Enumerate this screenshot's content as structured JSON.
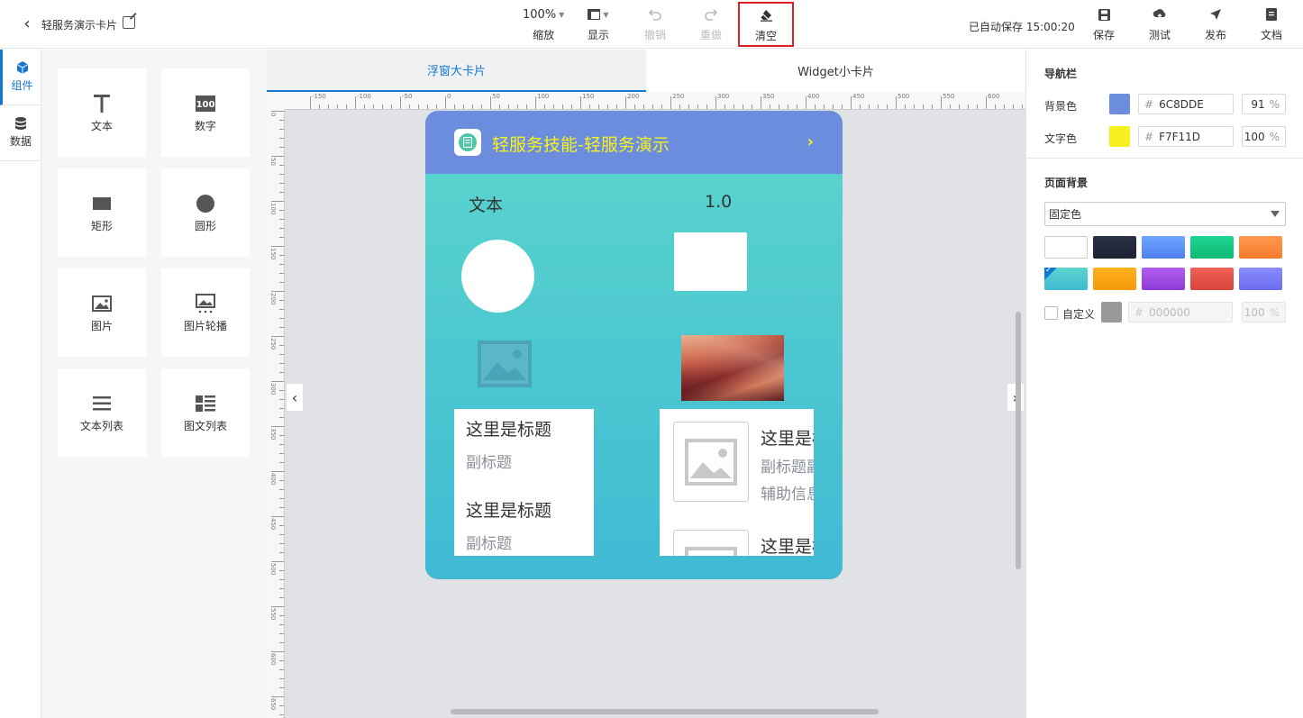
{
  "header": {
    "title": "轻服务演示卡片",
    "zoom": {
      "value": "100%",
      "label": "缩放"
    },
    "display": {
      "label": "显示"
    },
    "undo": {
      "label": "撤销"
    },
    "redo": {
      "label": "重做"
    },
    "clear": {
      "label": "清空"
    },
    "autosave": "已自动保存 15:00:20",
    "save": {
      "label": "保存"
    },
    "test": {
      "label": "测试"
    },
    "publish": {
      "label": "发布"
    },
    "docs": {
      "label": "文档"
    }
  },
  "sidebar_tabs": [
    {
      "label": "组件",
      "icon": "cube-icon",
      "active": true
    },
    {
      "label": "数据",
      "icon": "database-icon",
      "active": false
    }
  ],
  "components": [
    {
      "label": "文本",
      "icon": "text-icon"
    },
    {
      "label": "数字",
      "icon": "number-icon"
    },
    {
      "label": "矩形",
      "icon": "rectangle-icon"
    },
    {
      "label": "圆形",
      "icon": "circle-icon"
    },
    {
      "label": "图片",
      "icon": "image-icon"
    },
    {
      "label": "图片轮播",
      "icon": "carousel-icon"
    },
    {
      "label": "文本列表",
      "icon": "text-list-icon"
    },
    {
      "label": "图文列表",
      "icon": "image-text-list-icon"
    }
  ],
  "canvas_tabs": [
    {
      "label": "浮窗大卡片",
      "active": true
    },
    {
      "label": "Widget小卡片",
      "active": false
    }
  ],
  "ruler": {
    "h_labels": [
      "-150",
      "-100",
      "-50",
      "0",
      "50",
      "100",
      "150",
      "200",
      "250",
      "300",
      "350",
      "400",
      "450",
      "500",
      "550",
      "600",
      "650"
    ],
    "v_labels": [
      "0",
      "50",
      "100",
      "150",
      "200",
      "250",
      "300",
      "350",
      "400",
      "450",
      "500",
      "550",
      "600",
      "650"
    ]
  },
  "card": {
    "title": "轻服务技能-轻服务演示",
    "nav_bg": "#6c8dde",
    "title_color": "#f7f11d",
    "text_el": "文本",
    "number_el": "1.0",
    "text_list": [
      {
        "title": "这里是标题",
        "subtitle": "副标题"
      },
      {
        "title": "这里是标题",
        "subtitle": "副标题"
      }
    ],
    "image_list": [
      {
        "title": "这里是标题",
        "subtitle": "副标题副标题",
        "aux": "辅助信息"
      },
      {
        "title": "这里是标题",
        "subtitle": "",
        "aux": ""
      }
    ]
  },
  "props": {
    "nav_section": "导航栏",
    "bg_label": "背景色",
    "bg_hex": "6C8DDE",
    "bg_color": "#6c8dde",
    "bg_pct": "91",
    "text_label": "文字色",
    "text_hex": "F7F11D",
    "text_color": "#f7f11d",
    "text_pct": "100",
    "page_bg_section": "页面背景",
    "bg_mode": "固定色",
    "presets": [
      {
        "from": "#ffffff",
        "to": "#ffffff",
        "selected": false
      },
      {
        "from": "#2a3347",
        "to": "#1c2233",
        "selected": false
      },
      {
        "from": "#6ea6ff",
        "to": "#4f7ef0",
        "selected": false
      },
      {
        "from": "#1fd694",
        "to": "#0fb774",
        "selected": false
      },
      {
        "from": "#ff9a4f",
        "to": "#f57b2b",
        "selected": false
      },
      {
        "from": "#5bd6cc",
        "to": "#40bad4",
        "selected": true
      },
      {
        "from": "#ffb020",
        "to": "#f59a0a",
        "selected": false
      },
      {
        "from": "#b35ef0",
        "to": "#8e3bd8",
        "selected": false
      },
      {
        "from": "#f06158",
        "to": "#d8443c",
        "selected": false
      },
      {
        "from": "#8a8cff",
        "to": "#6a6cf0",
        "selected": false
      }
    ],
    "custom_label": "自定义",
    "custom_hex": "000000",
    "custom_pct": "100",
    "percent_sign": "%",
    "hash_sign": "#"
  }
}
